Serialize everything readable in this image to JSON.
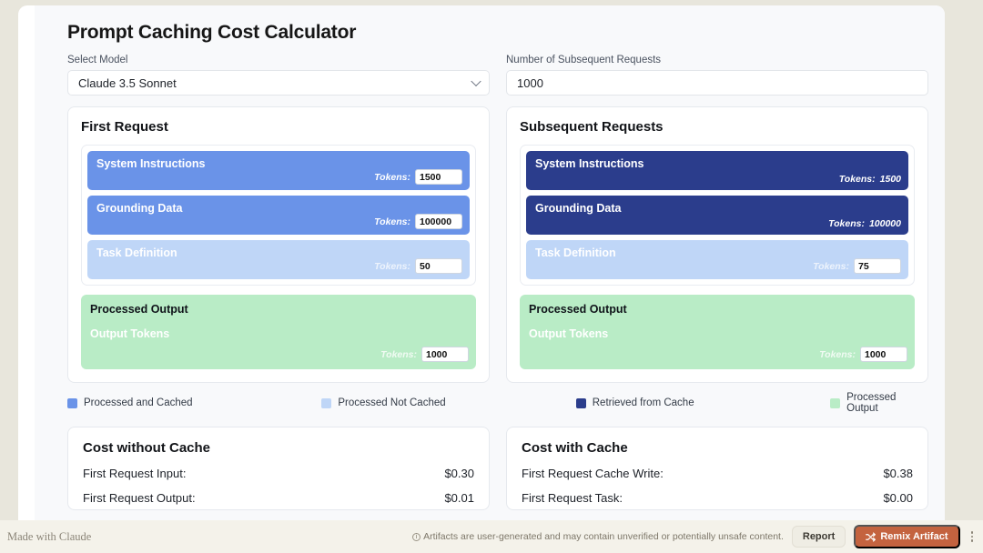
{
  "app": {
    "title": "Prompt Caching Cost Calculator"
  },
  "controls": {
    "model": {
      "label": "Select Model",
      "value": "Claude 3.5 Sonnet",
      "icon": "chevron-down-icon"
    },
    "requests": {
      "label": "Number of Subsequent Requests",
      "value": "1000"
    }
  },
  "first_request": {
    "heading": "First Request",
    "rows": [
      {
        "label": "System Instructions",
        "tokens_word": "Tokens:",
        "tokens": "1500",
        "style": "cached",
        "editable": true
      },
      {
        "label": "Grounding Data",
        "tokens_word": "Tokens:",
        "tokens": "100000",
        "style": "cached",
        "editable": true
      },
      {
        "label": "Task Definition",
        "tokens_word": "Tokens:",
        "tokens": "50",
        "style": "notcached",
        "editable": true
      }
    ],
    "output": {
      "heading": "Processed Output",
      "sub": "Output Tokens",
      "tokens_word": "Tokens:",
      "tokens": "1000"
    }
  },
  "subsequent_requests": {
    "heading": "Subsequent Requests",
    "rows": [
      {
        "label": "System Instructions",
        "tokens_word": "Tokens:",
        "tokens": "1500",
        "style": "retrieved",
        "editable": false
      },
      {
        "label": "Grounding Data",
        "tokens_word": "Tokens:",
        "tokens": "100000",
        "style": "retrieved",
        "editable": false
      },
      {
        "label": "Task Definition",
        "tokens_word": "Tokens:",
        "tokens": "75",
        "style": "notcached",
        "editable": true
      }
    ],
    "output": {
      "heading": "Processed Output",
      "sub": "Output Tokens",
      "tokens_word": "Tokens:",
      "tokens": "1000"
    }
  },
  "legend": [
    {
      "label": "Processed and Cached",
      "color": "#6a93e8"
    },
    {
      "label": "Processed Not Cached",
      "color": "#bfd6f7"
    },
    {
      "label": "Retrieved from Cache",
      "color": "#2b3d8c"
    },
    {
      "label": "Processed Output",
      "color": "#b9ecc6"
    }
  ],
  "cost_without_cache": {
    "heading": "Cost without Cache",
    "rows": [
      {
        "label": "First Request Input:",
        "value": "$0.30"
      },
      {
        "label": "First Request Output:",
        "value": "$0.01"
      }
    ]
  },
  "cost_with_cache": {
    "heading": "Cost with Cache",
    "rows": [
      {
        "label": "First Request Cache Write:",
        "value": "$0.38"
      },
      {
        "label": "First Request Task:",
        "value": "$0.00"
      }
    ]
  },
  "footer": {
    "made_with": "Made with Claude",
    "disclaimer": "Artifacts are user-generated and may contain unverified or potentially unsafe content.",
    "report_label": "Report",
    "remix_label": "Remix Artifact",
    "remix_icon": "shuffle-icon",
    "menu_icon": "kebab-menu-icon"
  }
}
